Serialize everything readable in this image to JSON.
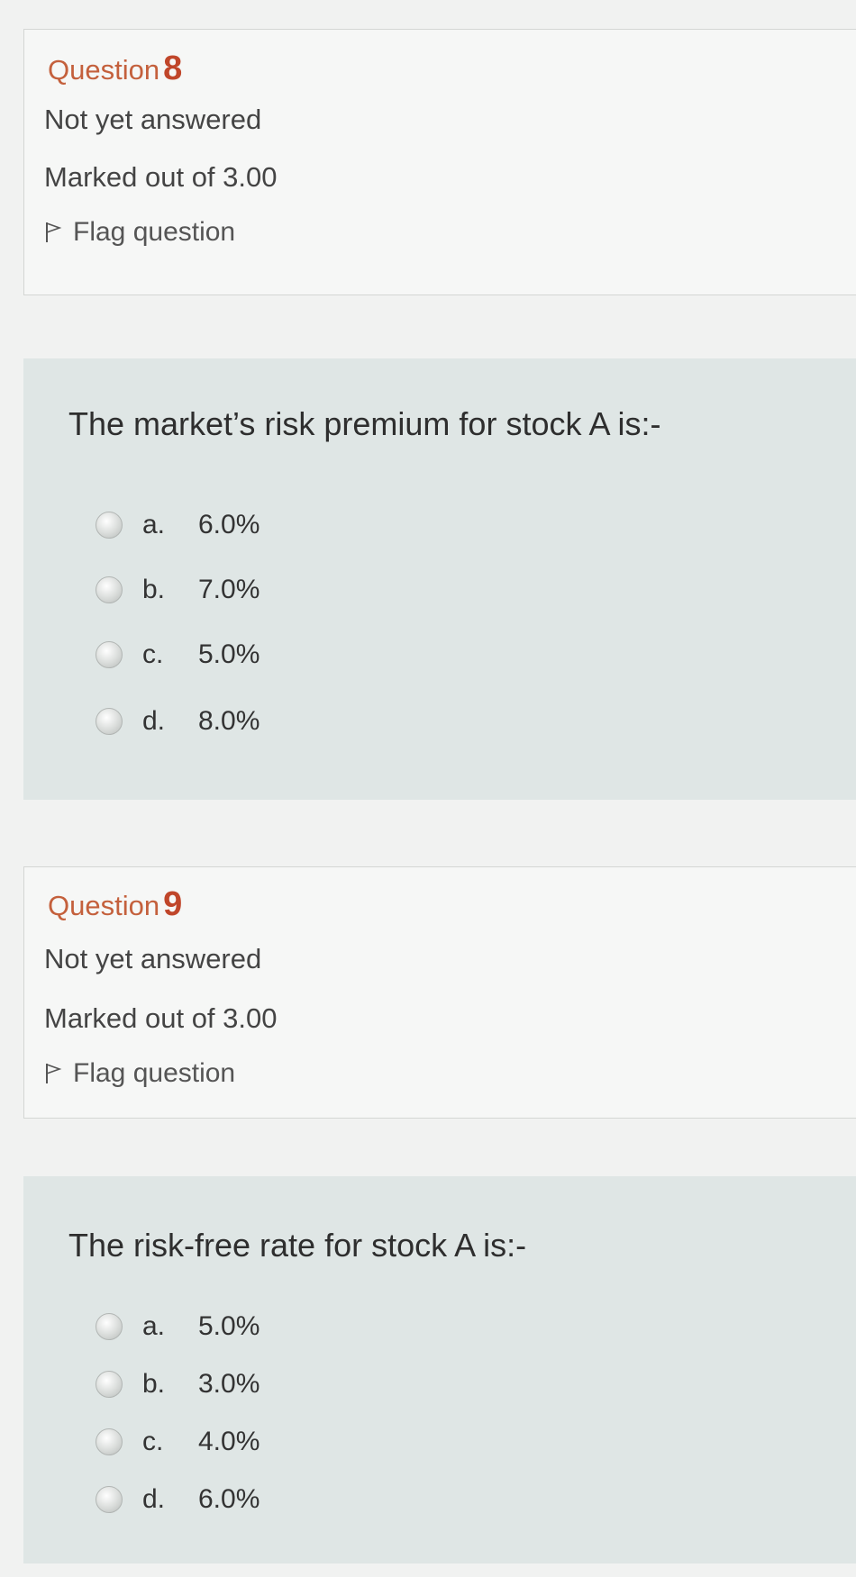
{
  "questions": [
    {
      "label": "Question",
      "number": "8",
      "status": "Not yet answered",
      "marks": "Marked out of 3.00",
      "flag_label": "Flag question",
      "text": "The market’s risk premium for stock A is:-",
      "options": [
        {
          "letter": "a.",
          "value": "6.0%"
        },
        {
          "letter": "b.",
          "value": "7.0%"
        },
        {
          "letter": "c.",
          "value": "5.0%"
        },
        {
          "letter": "d.",
          "value": "8.0%"
        }
      ]
    },
    {
      "label": "Question",
      "number": "9",
      "status": "Not yet answered",
      "marks": "Marked out of 3.00",
      "flag_label": "Flag question",
      "text": "The risk-free rate for stock A is:-",
      "options": [
        {
          "letter": "a.",
          "value": "5.0%"
        },
        {
          "letter": "b.",
          "value": "3.0%"
        },
        {
          "letter": "c.",
          "value": "4.0%"
        },
        {
          "letter": "d.",
          "value": "6.0%"
        }
      ]
    }
  ],
  "colors": {
    "accent": "#c0462a",
    "info_bg": "#f6f7f6",
    "content_bg": "#dfe6e5"
  },
  "icons": {
    "flag": "flag-icon",
    "radio": "radio-icon"
  }
}
